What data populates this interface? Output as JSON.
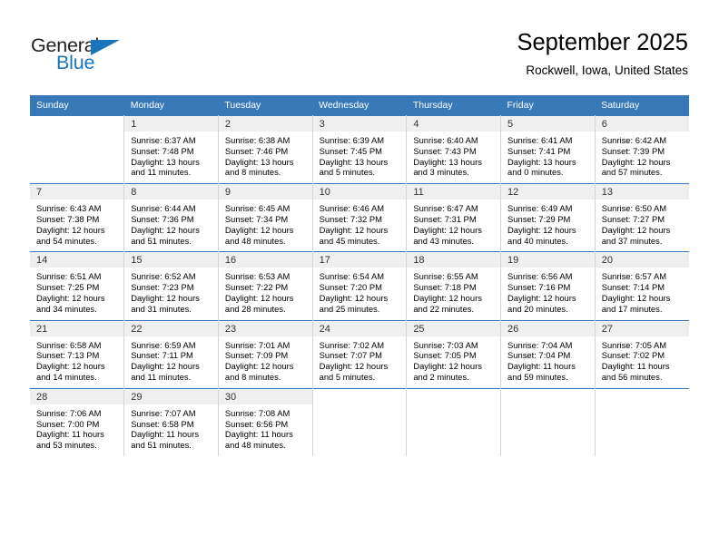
{
  "brand": {
    "name_dark": "General",
    "name_blue": "Blue",
    "accent_color": "#1b75bb"
  },
  "header": {
    "title": "September 2025",
    "subtitle": "Rockwell, Iowa, United States"
  },
  "theme": {
    "header_row_bg": "#3879ba",
    "daynum_band_bg": "#efefef",
    "grid_line": "#d4d4d4",
    "text": "#000000"
  },
  "weekday_headers": [
    "Sunday",
    "Monday",
    "Tuesday",
    "Wednesday",
    "Thursday",
    "Friday",
    "Saturday"
  ],
  "weeks": [
    [
      {
        "day": "",
        "empty": true
      },
      {
        "day": "1",
        "sunrise": "Sunrise: 6:37 AM",
        "sunset": "Sunset: 7:48 PM",
        "daylight_1": "Daylight: 13 hours",
        "daylight_2": "and 11 minutes."
      },
      {
        "day": "2",
        "sunrise": "Sunrise: 6:38 AM",
        "sunset": "Sunset: 7:46 PM",
        "daylight_1": "Daylight: 13 hours",
        "daylight_2": "and 8 minutes."
      },
      {
        "day": "3",
        "sunrise": "Sunrise: 6:39 AM",
        "sunset": "Sunset: 7:45 PM",
        "daylight_1": "Daylight: 13 hours",
        "daylight_2": "and 5 minutes."
      },
      {
        "day": "4",
        "sunrise": "Sunrise: 6:40 AM",
        "sunset": "Sunset: 7:43 PM",
        "daylight_1": "Daylight: 13 hours",
        "daylight_2": "and 3 minutes."
      },
      {
        "day": "5",
        "sunrise": "Sunrise: 6:41 AM",
        "sunset": "Sunset: 7:41 PM",
        "daylight_1": "Daylight: 13 hours",
        "daylight_2": "and 0 minutes."
      },
      {
        "day": "6",
        "sunrise": "Sunrise: 6:42 AM",
        "sunset": "Sunset: 7:39 PM",
        "daylight_1": "Daylight: 12 hours",
        "daylight_2": "and 57 minutes."
      }
    ],
    [
      {
        "day": "7",
        "sunrise": "Sunrise: 6:43 AM",
        "sunset": "Sunset: 7:38 PM",
        "daylight_1": "Daylight: 12 hours",
        "daylight_2": "and 54 minutes."
      },
      {
        "day": "8",
        "sunrise": "Sunrise: 6:44 AM",
        "sunset": "Sunset: 7:36 PM",
        "daylight_1": "Daylight: 12 hours",
        "daylight_2": "and 51 minutes."
      },
      {
        "day": "9",
        "sunrise": "Sunrise: 6:45 AM",
        "sunset": "Sunset: 7:34 PM",
        "daylight_1": "Daylight: 12 hours",
        "daylight_2": "and 48 minutes."
      },
      {
        "day": "10",
        "sunrise": "Sunrise: 6:46 AM",
        "sunset": "Sunset: 7:32 PM",
        "daylight_1": "Daylight: 12 hours",
        "daylight_2": "and 45 minutes."
      },
      {
        "day": "11",
        "sunrise": "Sunrise: 6:47 AM",
        "sunset": "Sunset: 7:31 PM",
        "daylight_1": "Daylight: 12 hours",
        "daylight_2": "and 43 minutes."
      },
      {
        "day": "12",
        "sunrise": "Sunrise: 6:49 AM",
        "sunset": "Sunset: 7:29 PM",
        "daylight_1": "Daylight: 12 hours",
        "daylight_2": "and 40 minutes."
      },
      {
        "day": "13",
        "sunrise": "Sunrise: 6:50 AM",
        "sunset": "Sunset: 7:27 PM",
        "daylight_1": "Daylight: 12 hours",
        "daylight_2": "and 37 minutes."
      }
    ],
    [
      {
        "day": "14",
        "sunrise": "Sunrise: 6:51 AM",
        "sunset": "Sunset: 7:25 PM",
        "daylight_1": "Daylight: 12 hours",
        "daylight_2": "and 34 minutes."
      },
      {
        "day": "15",
        "sunrise": "Sunrise: 6:52 AM",
        "sunset": "Sunset: 7:23 PM",
        "daylight_1": "Daylight: 12 hours",
        "daylight_2": "and 31 minutes."
      },
      {
        "day": "16",
        "sunrise": "Sunrise: 6:53 AM",
        "sunset": "Sunset: 7:22 PM",
        "daylight_1": "Daylight: 12 hours",
        "daylight_2": "and 28 minutes."
      },
      {
        "day": "17",
        "sunrise": "Sunrise: 6:54 AM",
        "sunset": "Sunset: 7:20 PM",
        "daylight_1": "Daylight: 12 hours",
        "daylight_2": "and 25 minutes."
      },
      {
        "day": "18",
        "sunrise": "Sunrise: 6:55 AM",
        "sunset": "Sunset: 7:18 PM",
        "daylight_1": "Daylight: 12 hours",
        "daylight_2": "and 22 minutes."
      },
      {
        "day": "19",
        "sunrise": "Sunrise: 6:56 AM",
        "sunset": "Sunset: 7:16 PM",
        "daylight_1": "Daylight: 12 hours",
        "daylight_2": "and 20 minutes."
      },
      {
        "day": "20",
        "sunrise": "Sunrise: 6:57 AM",
        "sunset": "Sunset: 7:14 PM",
        "daylight_1": "Daylight: 12 hours",
        "daylight_2": "and 17 minutes."
      }
    ],
    [
      {
        "day": "21",
        "sunrise": "Sunrise: 6:58 AM",
        "sunset": "Sunset: 7:13 PM",
        "daylight_1": "Daylight: 12 hours",
        "daylight_2": "and 14 minutes."
      },
      {
        "day": "22",
        "sunrise": "Sunrise: 6:59 AM",
        "sunset": "Sunset: 7:11 PM",
        "daylight_1": "Daylight: 12 hours",
        "daylight_2": "and 11 minutes."
      },
      {
        "day": "23",
        "sunrise": "Sunrise: 7:01 AM",
        "sunset": "Sunset: 7:09 PM",
        "daylight_1": "Daylight: 12 hours",
        "daylight_2": "and 8 minutes."
      },
      {
        "day": "24",
        "sunrise": "Sunrise: 7:02 AM",
        "sunset": "Sunset: 7:07 PM",
        "daylight_1": "Daylight: 12 hours",
        "daylight_2": "and 5 minutes."
      },
      {
        "day": "25",
        "sunrise": "Sunrise: 7:03 AM",
        "sunset": "Sunset: 7:05 PM",
        "daylight_1": "Daylight: 12 hours",
        "daylight_2": "and 2 minutes."
      },
      {
        "day": "26",
        "sunrise": "Sunrise: 7:04 AM",
        "sunset": "Sunset: 7:04 PM",
        "daylight_1": "Daylight: 11 hours",
        "daylight_2": "and 59 minutes."
      },
      {
        "day": "27",
        "sunrise": "Sunrise: 7:05 AM",
        "sunset": "Sunset: 7:02 PM",
        "daylight_1": "Daylight: 11 hours",
        "daylight_2": "and 56 minutes."
      }
    ],
    [
      {
        "day": "28",
        "sunrise": "Sunrise: 7:06 AM",
        "sunset": "Sunset: 7:00 PM",
        "daylight_1": "Daylight: 11 hours",
        "daylight_2": "and 53 minutes."
      },
      {
        "day": "29",
        "sunrise": "Sunrise: 7:07 AM",
        "sunset": "Sunset: 6:58 PM",
        "daylight_1": "Daylight: 11 hours",
        "daylight_2": "and 51 minutes."
      },
      {
        "day": "30",
        "sunrise": "Sunrise: 7:08 AM",
        "sunset": "Sunset: 6:56 PM",
        "daylight_1": "Daylight: 11 hours",
        "daylight_2": "and 48 minutes."
      },
      {
        "day": "",
        "empty": true
      },
      {
        "day": "",
        "empty": true
      },
      {
        "day": "",
        "empty": true
      },
      {
        "day": "",
        "empty": true
      }
    ]
  ]
}
